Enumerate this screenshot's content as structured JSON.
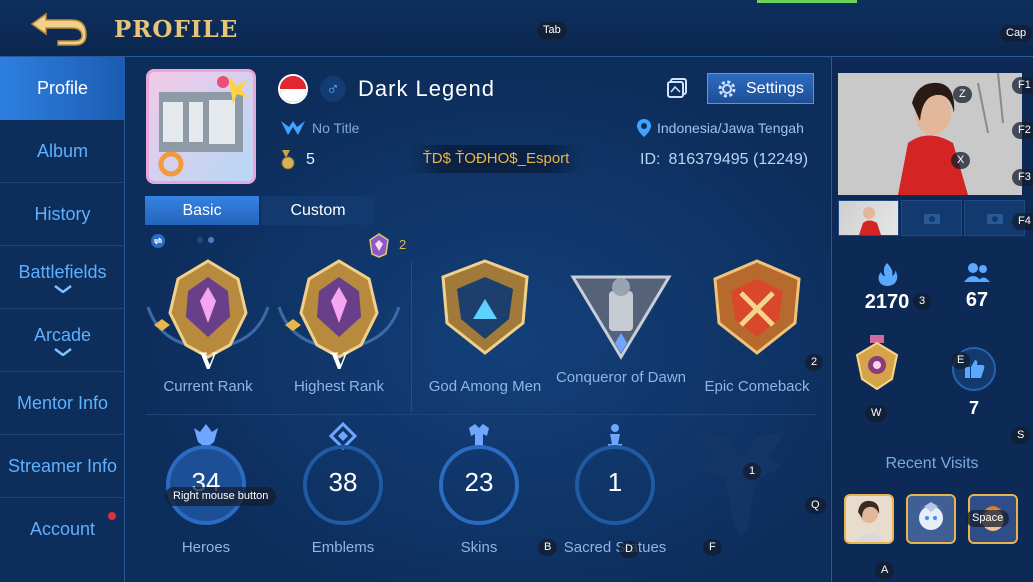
{
  "header": {
    "title": "PROFILE"
  },
  "sidebar": {
    "items": [
      {
        "label": "Profile",
        "active": true
      },
      {
        "label": "Album"
      },
      {
        "label": "History"
      },
      {
        "label": "Battlefields",
        "chevron": true
      },
      {
        "label": "Arcade",
        "chevron": true
      },
      {
        "label": "Mentor Info"
      },
      {
        "label": "Streamer Info"
      },
      {
        "label": "Account",
        "notification": true
      }
    ]
  },
  "profile": {
    "name": "Dark Legend",
    "gender_symbol": "♂",
    "title": "No Title",
    "level": "5",
    "squad": "ŤD$ ŤOĐHO$_Esport",
    "location": "Indonesia/Jawa Tengah",
    "id_label": "ID:",
    "id_value": "816379495 (12249)",
    "settings_label": "Settings"
  },
  "tabs": [
    {
      "label": "Basic",
      "active": true
    },
    {
      "label": "Custom"
    }
  ],
  "ranks": {
    "mythic_points": "2",
    "current": {
      "tier": "V",
      "label": "Current Rank"
    },
    "highest": {
      "tier": "V",
      "label": "Highest Rank"
    }
  },
  "achievements": [
    {
      "label": "God Among Men"
    },
    {
      "label": "Conqueror of Dawn"
    },
    {
      "label": "Epic Comeback"
    }
  ],
  "stats": [
    {
      "label": "Heroes",
      "value": "34"
    },
    {
      "label": "Emblems",
      "value": "38"
    },
    {
      "label": "Skins",
      "value": "23"
    },
    {
      "label": "Sacred Statues",
      "value": "1"
    }
  ],
  "right": {
    "popularity": "2170",
    "friends": "67",
    "likes": "7",
    "recent_visits_label": "Recent Visits"
  },
  "keycaps": {
    "tab": "Tab",
    "cap": "Cap",
    "f1": "F1",
    "f2": "F2",
    "f3": "F3",
    "f4": "F4",
    "z": "Z",
    "x": "X",
    "k3": "3",
    "k2": "2",
    "e": "E",
    "w": "W",
    "s": "S",
    "k1": "1",
    "q": "Q",
    "b": "B",
    "d": "D",
    "f": "F",
    "a": "A",
    "space": "Space",
    "rmb": "Right mouse button"
  },
  "colors": {
    "accent": "#2e7fe0",
    "gold": "#e8c47a",
    "bg": "#0c2a55"
  }
}
